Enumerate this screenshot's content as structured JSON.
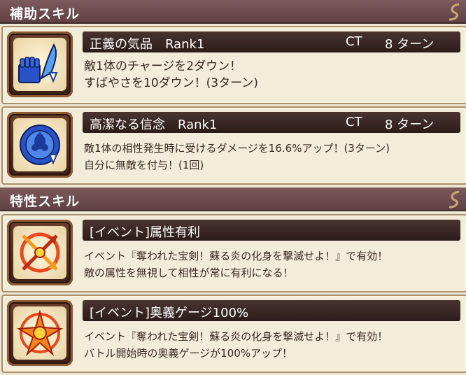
{
  "support_section": {
    "title": "補助スキル"
  },
  "trait_section": {
    "title": "特性スキル"
  },
  "support_skills": [
    {
      "name": "正義の気品　Rank1",
      "ct_label": "CT",
      "ct_value": "8 ターン",
      "lines": [
        "敵1体のチャージを2ダウン！",
        "すばやさを10ダウン！(3ターン)"
      ],
      "icon": "blue-gauntlet-down-icon"
    },
    {
      "name": "高潔なる信念　Rank1",
      "ct_label": "CT",
      "ct_value": "8 ターン",
      "lines": [
        "敵1体の相性発生時に受けるダメージを16.6%アップ！(3ターン)",
        "自分に無敵を付与！(1回)"
      ],
      "icon": "blue-shield-emblem-icon"
    }
  ],
  "trait_skills": [
    {
      "name": "[イベント]属性有利",
      "lines": [
        "イベント『奪われた宝剣！蘇る炎の化身を撃滅せよ！』で有効！",
        "敵の属性を無視して相性が常に有利になる！"
      ],
      "icon": "orange-crossed-arrows-icon"
    },
    {
      "name": "[イベント]奥義ゲージ100%",
      "lines": [
        "イベント『奪われた宝剣！蘇る炎の化身を撃滅せよ！』で有効！",
        "バトル開始時の奥義ゲージが100%アップ！"
      ],
      "icon": "orange-star-burst-icon"
    }
  ],
  "colors": {
    "header": "#6e4d50",
    "name_bar": "#3a2824",
    "card_bg": "#f3ecd9",
    "card_border": "#a88e6b"
  }
}
